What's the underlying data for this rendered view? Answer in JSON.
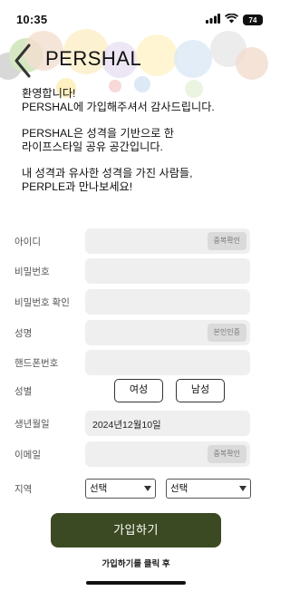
{
  "status_bar": {
    "time": "10:35",
    "battery": "74"
  },
  "header": {
    "title": "PERSHAL"
  },
  "intro": [
    "환영합니다!\nPERSHAL에 가입해주셔서 감사드립니다.",
    "PERSHAL은 성격을 기반으로 한\n라이프스타일 공유 공간입니다.",
    "내 성격과 유사한 성격을 가진 사람들,\nPERPLE과 만나보세요!"
  ],
  "form": {
    "id_label": "아이디",
    "id_check_button": "중복확인",
    "password_label": "비밀번호",
    "password_confirm_label": "비밀번호 확인",
    "name_label": "성명",
    "name_verify_button": "본인인증",
    "phone_label": "핸드폰번호",
    "gender_label": "성별",
    "gender_female": "여성",
    "gender_male": "남성",
    "birth_label": "생년월일",
    "birth_value": "2024년12월10일",
    "email_label": "이메일",
    "email_check_button": "중복확인",
    "region_label": "지역",
    "region_select_1": "선택",
    "region_select_2": "선택"
  },
  "submit_label": "가입하기",
  "note": "가입하기를 클릭 후",
  "colors": {
    "submit_bg": "#3b4a22",
    "field_bg": "#efefef"
  }
}
